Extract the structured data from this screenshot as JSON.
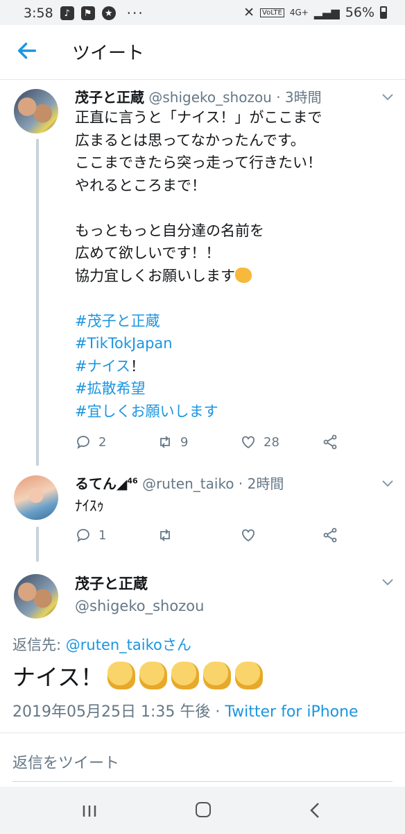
{
  "status_bar": {
    "time": "3:58",
    "network": "4G+",
    "volte": "VoLTE",
    "battery": "56%"
  },
  "header": {
    "title": "ツイート"
  },
  "tweets": [
    {
      "name": "茂子と正蔵",
      "handle": "@shigeko_shozou",
      "time": "· 3時間",
      "lines": [
        "正直に言うと「ナイス！」がここまで",
        "広まるとは思ってなかったんです。",
        "ここまできたら突っ走って行きたい！",
        "やれるところまで！",
        "",
        "もっともっと自分達の名前を",
        "広めて欲しいです！！",
        "協力宜しくお願いします"
      ],
      "hashtags": [
        "#茂子と正蔵",
        "#TikTokJapan",
        "#ナイス",
        "#拡散希望",
        "#宜しくお願いします"
      ],
      "hashtag_suffix": "！",
      "replies": "2",
      "retweets": "9",
      "likes": "28"
    },
    {
      "name": "るてん",
      "name_suffix": "46",
      "handle": "@ruten_taiko",
      "time": "· 2時間",
      "text": "ﾅｲｽｩ",
      "replies": "1"
    }
  ],
  "focused_tweet": {
    "name": "茂子と正蔵",
    "handle": "@shigeko_shozou",
    "reply_to_label": "返信先:",
    "reply_to_handle": "@ruten_taiko",
    "reply_to_suffix": "さん",
    "text": "ナイス！",
    "timestamp": "2019年05月25日 1:35 午後 ·",
    "source": "Twitter for iPhone"
  },
  "reply_input": {
    "placeholder": "返信をツイート"
  },
  "colors": {
    "link": "#1b95e0",
    "secondary_text": "#657786",
    "thread_line": "#c9d3da"
  }
}
